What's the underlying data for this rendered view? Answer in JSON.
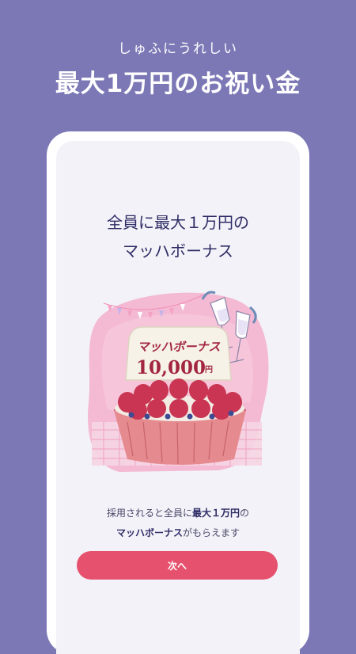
{
  "header": {
    "subtitle": "しゅふにうれしい",
    "title": "最大1万円のお祝い金"
  },
  "card": {
    "headline_line1": "全員に最大１万円の",
    "headline_line2": "マッハボーナス",
    "illustration": {
      "sign_title": "マッハボーナス",
      "sign_amount": "10,000",
      "sign_unit": "円"
    },
    "desc_line1_pre": "採用されると全員に",
    "desc_line1_bold": "最大１万円",
    "desc_line1_post": "の",
    "desc_line2_bold": "マッハボーナス",
    "desc_line2_post": "がもらえます",
    "next_button": "次へ"
  },
  "colors": {
    "background": "#7c78b6",
    "accent": "#e6526e",
    "text_dark": "#2f2d66"
  }
}
